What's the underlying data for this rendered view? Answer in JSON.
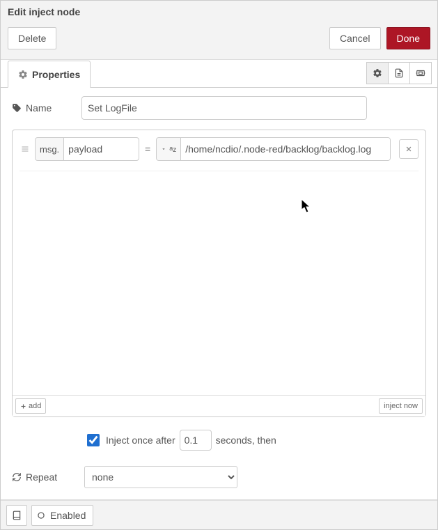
{
  "header": {
    "title": "Edit inject node",
    "delete": "Delete",
    "cancel": "Cancel",
    "done": "Done"
  },
  "tabs": {
    "properties": "Properties"
  },
  "form": {
    "name_label": "Name",
    "name_value": "Set LogFile",
    "props": [
      {
        "key_prefix": "msg.",
        "key": "payload",
        "type_label": "a_z",
        "value": "/home/ncdio/.node-red/backlog/backlog.log"
      }
    ],
    "add_label": "add",
    "inject_now": "inject now",
    "inject_once": {
      "checked": true,
      "label_before": "Inject once after",
      "delay": "0.1",
      "label_after": "seconds, then"
    },
    "repeat_label": "Repeat",
    "repeat_value": "none"
  },
  "footer": {
    "enabled": "Enabled"
  }
}
